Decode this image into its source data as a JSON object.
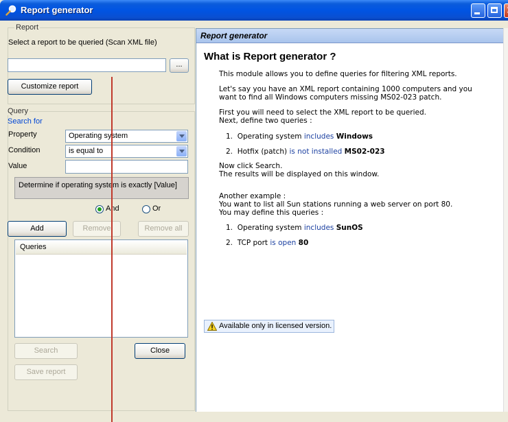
{
  "window": {
    "title": "Report generator",
    "colors": {
      "titlebar": "#0054e3",
      "panel": "#ece9d8",
      "accent_line": "#c0392b"
    }
  },
  "icons": {
    "title": "magnifier-icon",
    "warning": "warning-icon"
  },
  "report": {
    "legend": "Report",
    "select_label": "Select a report to be queried (Scan XML file)",
    "file_value": "",
    "browse_label": "...",
    "customize_label": "Customize report"
  },
  "query": {
    "legend": "Query",
    "search_for": "Search for",
    "property_label": "Property",
    "property_value": "Operating system",
    "condition_label": "Condition",
    "condition_value": "is equal to",
    "value_label": "Value",
    "value_value": "",
    "description": "Determine if operating system is exactly [Value]",
    "and_label": "And",
    "or_label": "Or",
    "selected_operator": "And",
    "add_label": "Add",
    "remove_label": "Remove",
    "remove_all_label": "Remove all",
    "queries_header": "Queries"
  },
  "actions": {
    "search_label": "Search",
    "close_label": "Close",
    "save_label": "Save report"
  },
  "help": {
    "header": "Report generator",
    "heading": "What is Report generator ?",
    "intro": "This module allows you to define queries for filtering XML reports.",
    "example1_line1": "Let's say you have an XML report containing 1000 computers and you",
    "example1_line2": "want to find all Windows computers missing MS02-023 patch.",
    "step_line1": "First you will need to select the XML report to be queried.",
    "step_line2": "Next, define two queries :",
    "q1": {
      "num": "1.",
      "prop": "Operating system",
      "cond": "includes",
      "val": "Windows"
    },
    "q2": {
      "num": "2.",
      "prop": "Hotfix (patch)",
      "cond": "is not installed",
      "val": "MS02-023"
    },
    "now_line1": "Now click Search.",
    "now_line2": "The results will be displayed on this window.",
    "another_line1": "Another example :",
    "another_line2": "You want to list all Sun stations running a web server on port 80.",
    "another_line3": "You may define this queries :",
    "q3": {
      "num": "1.",
      "prop": "Operating system",
      "cond": "includes",
      "val": "SunOS"
    },
    "q4": {
      "num": "2.",
      "prop": "TCP port",
      "cond": "is open",
      "val": "80"
    },
    "warning": "Available only in licensed version."
  }
}
